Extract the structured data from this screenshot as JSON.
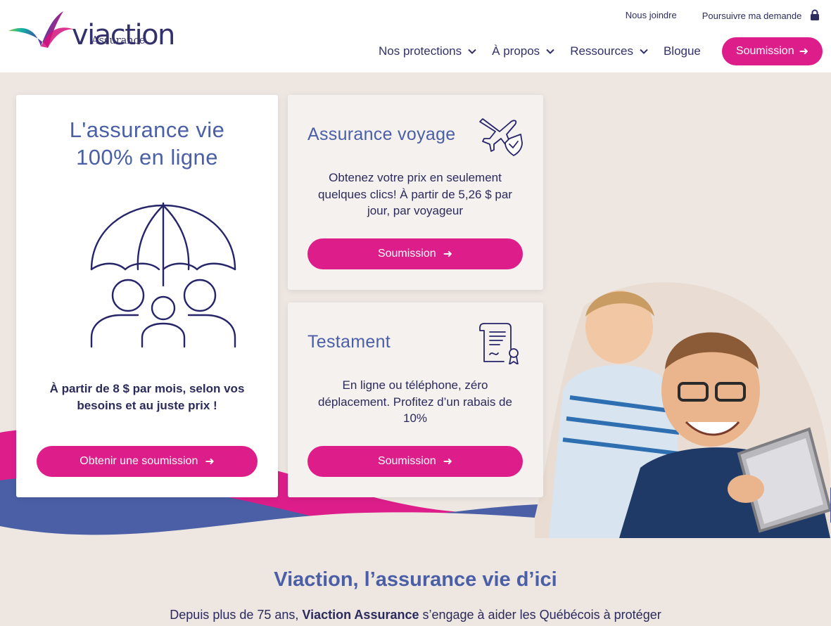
{
  "header": {
    "logo_name": "viaction",
    "logo_sub": "Assurance",
    "top_links": {
      "contact": "Nous joindre",
      "track": "Poursuivre ma demande"
    },
    "nav": {
      "protections": "Nos protections",
      "about": "À propos",
      "resources": "Ressources",
      "blog": "Blogue",
      "cta": "Soumission",
      "cta_arrow": "➜"
    }
  },
  "colors": {
    "accent": "#dc1d8a",
    "title_blue": "#4a5fa6",
    "navy": "#2b2a5c",
    "background": "#ede6e1",
    "wave_blue": "#4a5fa6"
  },
  "hero": {
    "main_card": {
      "title_line1": "L'assurance vie",
      "title_line2": "100% en ligne",
      "illustration": "umbrella-family-icon",
      "text": "À partir de 8 $ par mois, selon vos besoins et au juste prix !",
      "button": "Obtenir une soumission",
      "arrow": "➜"
    },
    "travel_card": {
      "title": "Assurance voyage",
      "icon": "plane-shield-icon",
      "text": "Obtenez votre prix en seulement quelques clics! À partir de 5,26 $ par jour, par voyageur",
      "button": "Soumission",
      "arrow": "➜"
    },
    "will_card": {
      "title": "Testament",
      "icon": "document-signature-icon",
      "text": "En ligne ou téléphone, zéro déplacement. Profitez d’un rabais de 10%",
      "button": "Soumission",
      "arrow": "➜"
    }
  },
  "about": {
    "title": "Viaction, l’assurance vie d’ici",
    "text_before": "Depuis plus de 75 ans, ",
    "text_bold": "Viaction Assurance",
    "text_after": " s’engage à aider les Québécois à protéger"
  }
}
